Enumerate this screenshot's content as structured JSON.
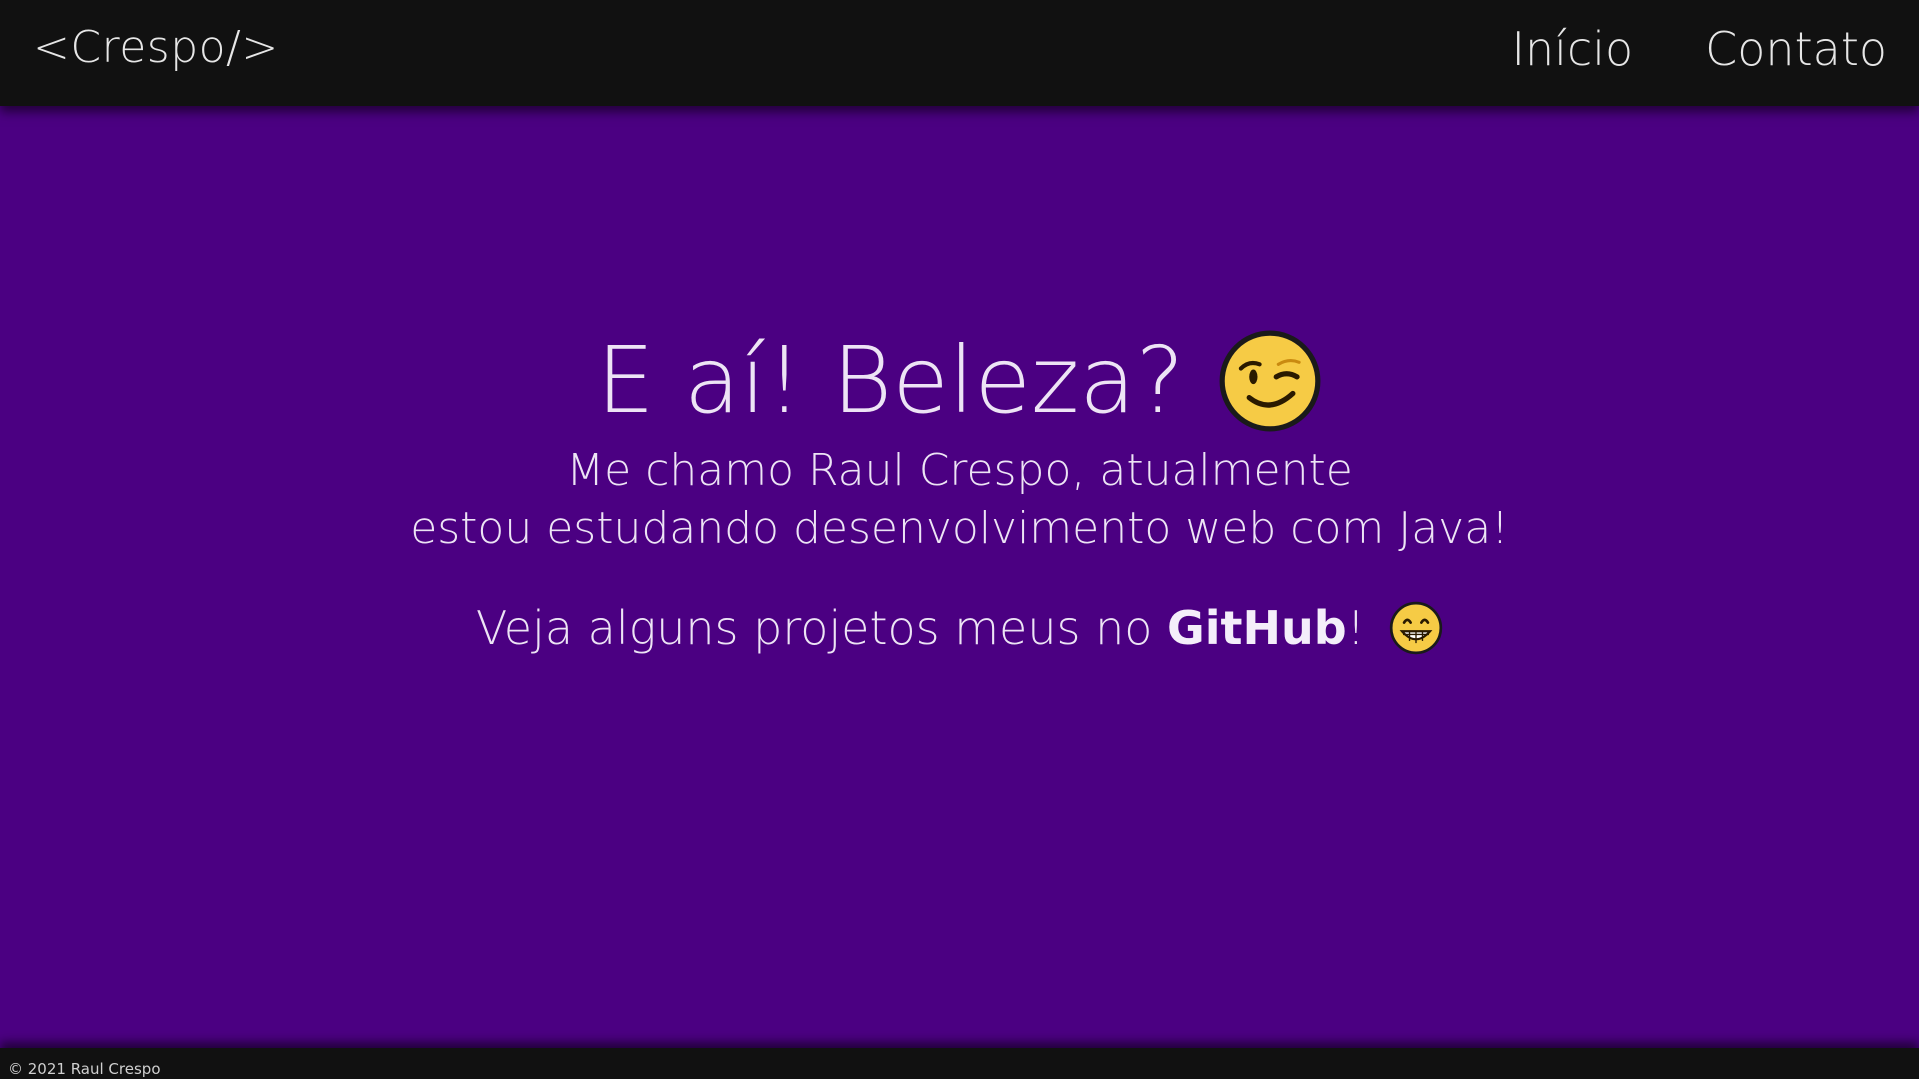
{
  "header": {
    "logo": "<Crespo/>",
    "nav": [
      {
        "label": "Início"
      },
      {
        "label": "Contato"
      }
    ]
  },
  "hero": {
    "headline": "E aí! Beleza?",
    "headline_emoji": "winking-face-emoji",
    "intro_line1": "Me chamo Raul Crespo, atualmente",
    "intro_line2": "estou estudando desenvolvimento web com Java!",
    "github_prefix": "Veja alguns projetos meus no ",
    "github_link": "GitHub",
    "github_suffix": "!",
    "github_emoji": "grinning-face-emoji"
  },
  "footer": {
    "copyright": "© 2021 Raul Crespo"
  },
  "colors": {
    "background": "#4b0082",
    "bar": "#111111",
    "text": "#ede4f5",
    "emoji_yellow": "#f6cb45"
  }
}
